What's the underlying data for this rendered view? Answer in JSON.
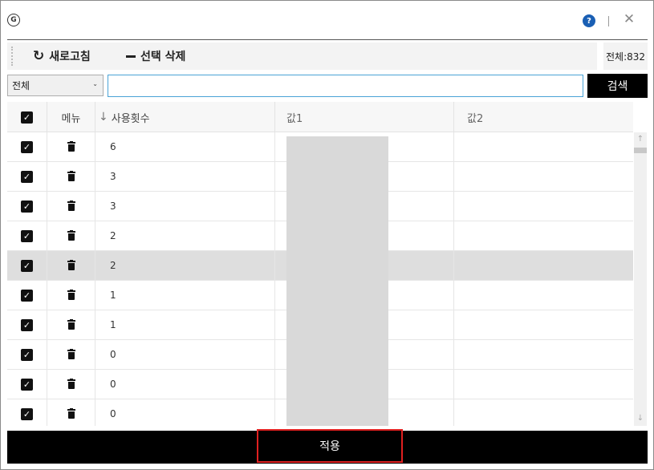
{
  "titlebar": {
    "logo_glyph": "G",
    "help_glyph": "?",
    "close_glyph": "✕"
  },
  "toolbar": {
    "refresh_label": "새로고침",
    "refresh_icon": "↻",
    "delete_label": "선택 삭제",
    "total_label": "전체:832"
  },
  "search": {
    "filter_value": "전체",
    "filter_chevron": "⌄",
    "query_value": "",
    "button_label": "검색"
  },
  "grid": {
    "headers": {
      "check": "✓",
      "menu": "메뉴",
      "sort_arrow": "↓",
      "count": "사용횟수",
      "value1": "값1",
      "value2": "값2"
    },
    "rows": [
      {
        "count": "6",
        "checked": true,
        "selected": false
      },
      {
        "count": "3",
        "checked": true,
        "selected": false
      },
      {
        "count": "3",
        "checked": true,
        "selected": false
      },
      {
        "count": "2",
        "checked": true,
        "selected": false
      },
      {
        "count": "2",
        "checked": true,
        "selected": true
      },
      {
        "count": "1",
        "checked": true,
        "selected": false
      },
      {
        "count": "1",
        "checked": true,
        "selected": false
      },
      {
        "count": "0",
        "checked": true,
        "selected": false
      },
      {
        "count": "0",
        "checked": true,
        "selected": false
      },
      {
        "count": "0",
        "checked": true,
        "selected": false
      }
    ]
  },
  "scrollbar": {
    "up_glyph": "↑",
    "down_glyph": "↓"
  },
  "footer": {
    "apply_label": "적용"
  },
  "colors": {
    "accent_black": "#000000",
    "help_blue": "#1a5fb4",
    "highlight_red": "#e02020",
    "selected_row": "#dedede"
  }
}
